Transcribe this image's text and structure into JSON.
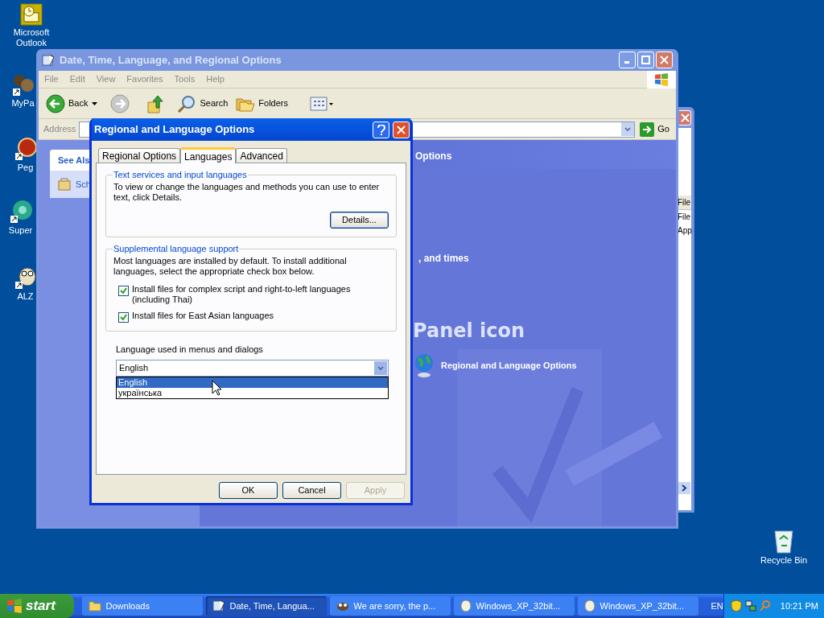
{
  "desktop": {
    "icons": [
      {
        "label": "Microsoft Outlook",
        "kind": "outlook"
      },
      {
        "label": "MyPa",
        "kind": "game"
      },
      {
        "label": "Peg",
        "kind": "ball"
      },
      {
        "label": "Super",
        "kind": "disc"
      },
      {
        "label": "ALZ",
        "kind": "mascot"
      },
      {
        "label": "Recycle Bin",
        "kind": "recycle"
      }
    ]
  },
  "back_window": {
    "items": [
      "File",
      "File",
      "App"
    ]
  },
  "explorer": {
    "title": "Date, Time, Language, and Regional Options",
    "active": false,
    "menu": [
      "File",
      "Edit",
      "View",
      "Favorites",
      "Tools",
      "Help"
    ],
    "toolbar": [
      {
        "label": "Back",
        "kind": "back"
      },
      {
        "label": "Search",
        "kind": "search"
      },
      {
        "label": "Folders",
        "kind": "folders"
      }
    ],
    "address_label": "Address",
    "go": "Go",
    "see_also": {
      "title": "See Als",
      "item": "Sch"
    },
    "content": {
      "heading": "Options",
      "line": ", and times",
      "big_heading": "Panel icon",
      "link": "Regional and Language Options"
    }
  },
  "dialog": {
    "title": "Regional and Language Options",
    "tabs": [
      {
        "label": "Regional Options",
        "selected": false
      },
      {
        "label": "Languages",
        "selected": true
      },
      {
        "label": "Advanced",
        "selected": false
      }
    ],
    "text_services": {
      "title": "Text services and input languages",
      "text": "To view or change the languages and methods you can use to enter text, click Details.",
      "button": "Details..."
    },
    "supplemental": {
      "title": "Supplemental language support",
      "text": "Most languages are installed by default. To install additional languages, select the appropriate check box below.",
      "checkboxes": [
        {
          "label": "Install files for complex script and right-to-left languages (including Thai)",
          "checked": true
        },
        {
          "label": "Install files for East Asian languages",
          "checked": true
        }
      ]
    },
    "ui_language": {
      "label": "Language used in menus and dialogs",
      "value": "English",
      "expanded": true,
      "options": [
        {
          "label": "English",
          "selected": true
        },
        {
          "label": "українська",
          "selected": false
        }
      ]
    },
    "buttons": [
      {
        "label": "OK",
        "disabled": false
      },
      {
        "label": "Cancel",
        "disabled": false
      },
      {
        "label": "Apply",
        "disabled": true
      }
    ]
  },
  "taskbar": {
    "start": "start",
    "items": [
      {
        "label": "Downloads",
        "kind": "folder",
        "selected": false
      },
      {
        "label": "Date, Time, Langua...",
        "kind": "panel",
        "selected": true
      },
      {
        "label": "We are sorry, the p...",
        "kind": "browser",
        "selected": false
      },
      {
        "label": "Windows_XP_32bit...",
        "kind": "media",
        "selected": false
      },
      {
        "label": "Windows_XP_32bit...",
        "kind": "media",
        "selected": false
      }
    ],
    "language": "EN",
    "clock": "10:21 PM"
  }
}
